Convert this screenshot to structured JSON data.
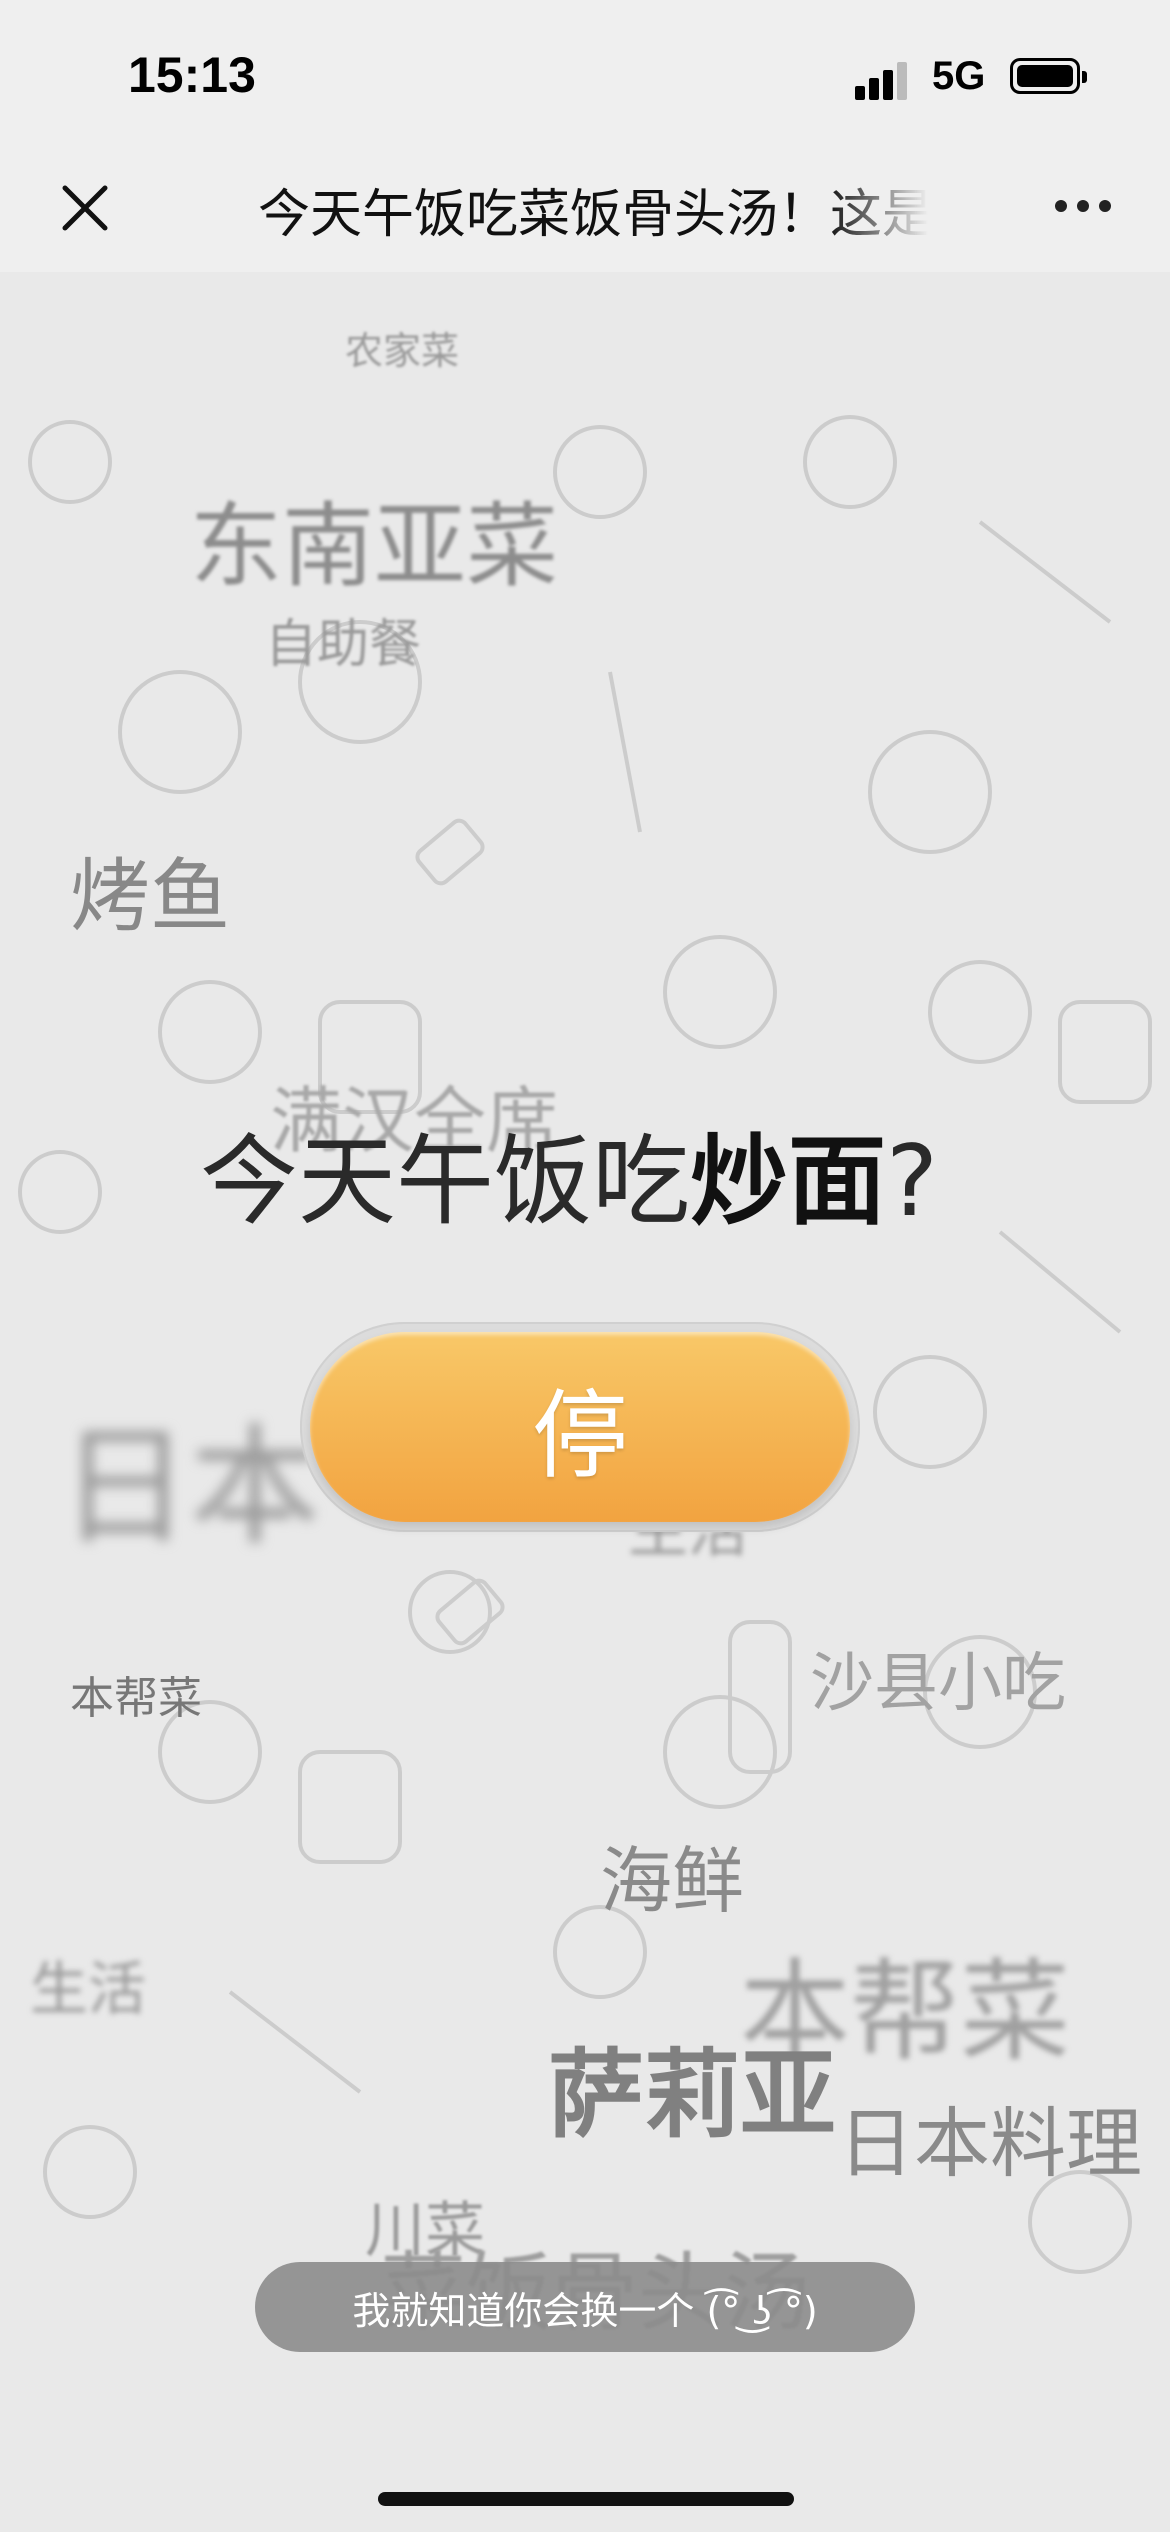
{
  "status_bar": {
    "time": "15:13",
    "network": "5G"
  },
  "nav": {
    "title": "今天午饭吃菜饭骨头汤！这是"
  },
  "question": {
    "prefix": "今天午饭吃",
    "dish": "炒面",
    "suffix": "?"
  },
  "stop_button": {
    "label": "停"
  },
  "floating_words": [
    "农家菜",
    "东南亚菜",
    "自助餐",
    "烤鱼",
    "满汉全席",
    "日本",
    "生活",
    "本帮菜",
    "沙县小吃",
    "海鲜",
    "本帮菜",
    "生活",
    "萨莉亚",
    "日本料理",
    "川菜",
    "菜饭骨头汤"
  ],
  "toast": {
    "text": "我就知道你会换一个 (͡° ͜ʖ ͡°)"
  }
}
